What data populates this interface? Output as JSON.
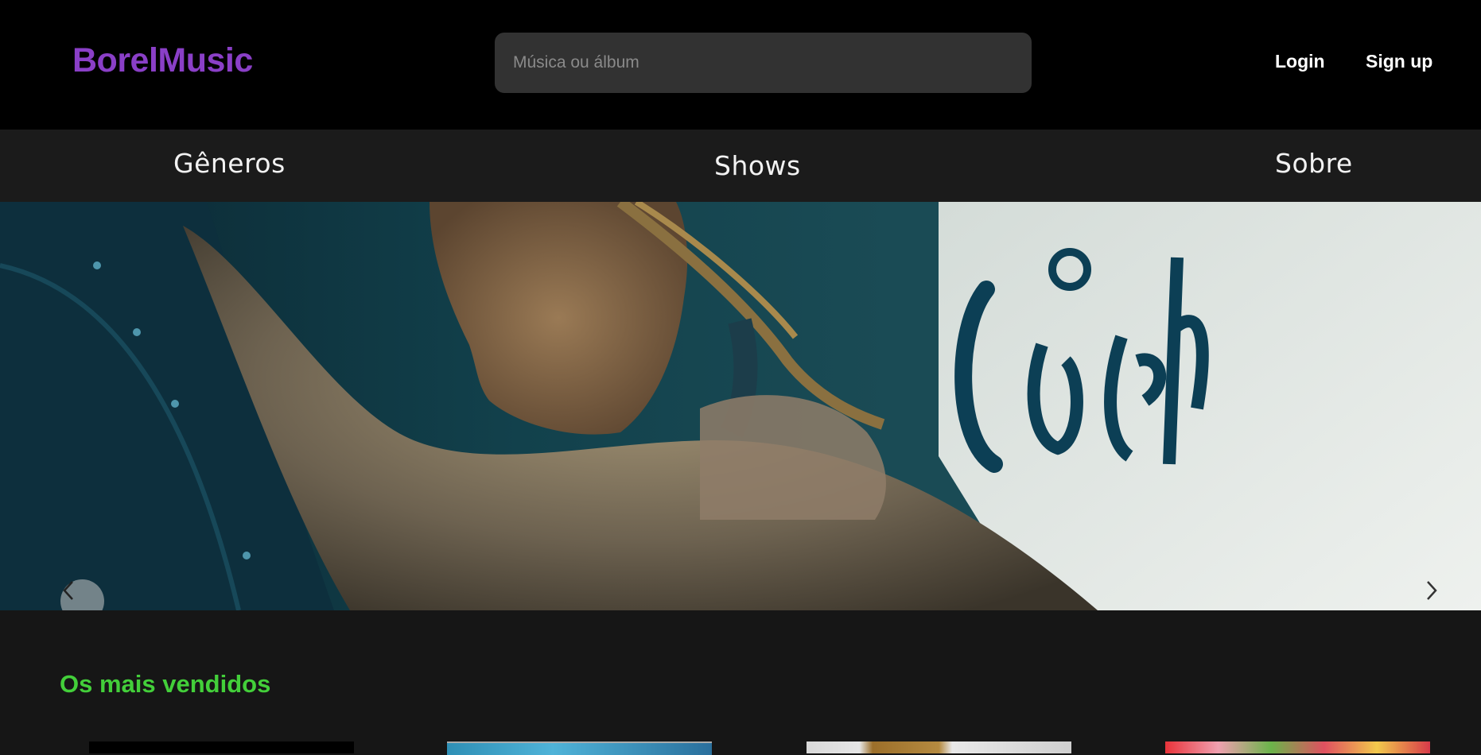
{
  "header": {
    "logo": "BorelMusic",
    "search": {
      "placeholder": "Música ou álbum",
      "value": ""
    },
    "login_label": "Login",
    "signup_label": "Sign up"
  },
  "nav": {
    "items": [
      {
        "label": "Gêneros"
      },
      {
        "label": "Shows"
      },
      {
        "label": "Sobre"
      }
    ]
  },
  "carousel": {
    "prev_icon": "chevron-left-icon",
    "next_icon": "chevron-right-icon"
  },
  "bestsellers": {
    "title": "Os mais vendidos"
  },
  "colors": {
    "brand": "#8a3fc7",
    "section_title": "#43cf3a",
    "background": "#161616",
    "topbar": "#000000",
    "search_bg": "#323232"
  }
}
